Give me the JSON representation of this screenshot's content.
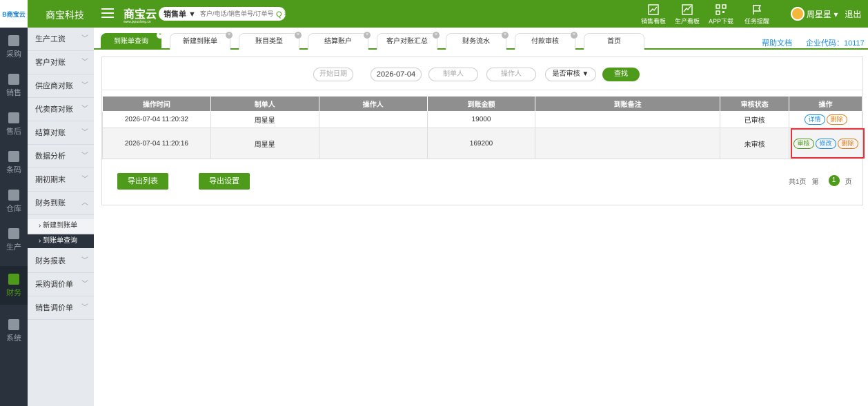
{
  "header": {
    "logo_text": "B商宝云",
    "brand": "商宝科技",
    "cloud_name": "商宝云",
    "cloud_domain": "www.jxpuslong.cn",
    "search_type": "销售单 ▼",
    "search_placeholder": "客户/电话/销售单号/订单号",
    "search_label": "Q 搜索",
    "tools": [
      "销售看板",
      "生产看板",
      "APP下载",
      "任务提醒"
    ],
    "user_name": "周星星 ▾",
    "logout": "退出"
  },
  "rail": [
    {
      "label": "采购",
      "icon": "cart-icon"
    },
    {
      "label": "销售",
      "icon": "sales-icon"
    },
    {
      "label": "售后",
      "icon": "after-sales-icon"
    },
    {
      "label": "条码",
      "icon": "barcode-icon"
    },
    {
      "label": "仓库",
      "icon": "warehouse-icon"
    },
    {
      "label": "生产",
      "icon": "robot-arm-icon"
    },
    {
      "label": "财务",
      "icon": "calculator-icon",
      "active": true
    },
    {
      "label": "系统",
      "icon": "gear-icon"
    }
  ],
  "subnav": {
    "items": [
      "生产工资",
      "客户对账",
      "供应商对账",
      "代卖商对账",
      "结算对账",
      "数据分析",
      "期初期末",
      "财务到账"
    ],
    "sub_items": [
      "› 新建到账单",
      "› 到账单查询"
    ],
    "after_items": [
      "财务报表",
      "采购调价单",
      "销售调价单"
    ]
  },
  "tabs": [
    "到账单查询",
    "新建到账单",
    "账目类型",
    "结算账户",
    "客户对账汇总",
    "财务流水",
    "付款审核",
    "首页"
  ],
  "top_links": {
    "help": "帮助文档",
    "company": "企业代码：10117"
  },
  "filters": {
    "start_date": "开始日期",
    "end_date": "2026-07-04",
    "maker": "制单人",
    "operator": "操作人",
    "audit_select": "是否审核 ▼",
    "find": "查找"
  },
  "table": {
    "columns": [
      "操作时间",
      "制单人",
      "操作人",
      "到账金额",
      "到账备注",
      "审核状态",
      "操作"
    ],
    "rows": [
      {
        "time": "2026-07-04 11:20:32",
        "maker": "周星星",
        "operator": "",
        "amount": "19000",
        "note": "",
        "status": "已审核",
        "ops": [
          "详情",
          "删除"
        ]
      },
      {
        "time": "2026-07-04 11:20:16",
        "maker": "周星星",
        "operator": "",
        "amount": "169200",
        "note": "",
        "status": "未审核",
        "ops": [
          "审核",
          "修改",
          "删除"
        ]
      }
    ]
  },
  "footer": {
    "export_list": "导出列表",
    "export_settings": "导出设置",
    "pager_total": "共1页",
    "pager_di": "第",
    "pager_current": "1",
    "pager_ye": "页"
  },
  "colors": {
    "accent": "#4e9a1a",
    "rail": "#2a323d",
    "highlight": "#e5333a"
  }
}
